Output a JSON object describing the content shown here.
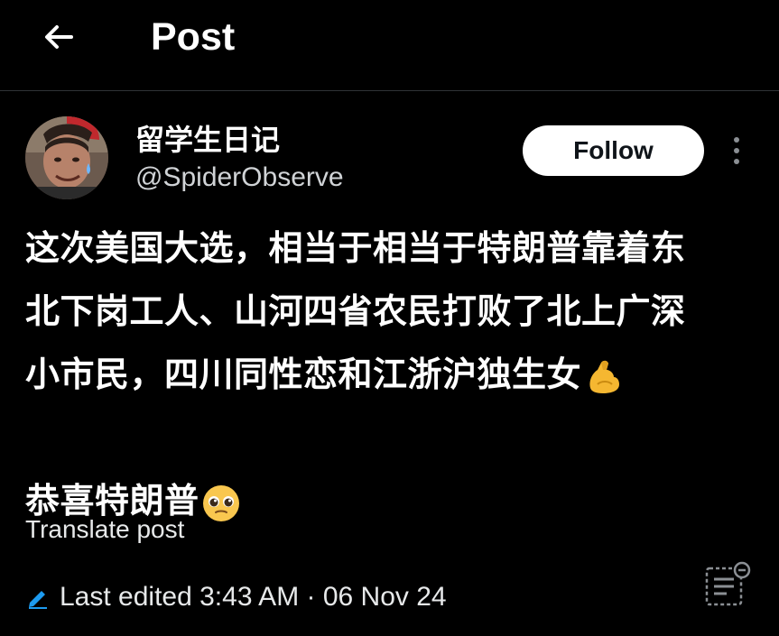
{
  "header": {
    "title": "Post",
    "back_icon": "arrow-left-icon"
  },
  "author": {
    "display_name": "留学生日记",
    "handle": "@SpiderObserve",
    "follow_label": "Follow",
    "more_icon": "more-vertical-icon"
  },
  "post": {
    "lines": [
      "这次美国大选，相当于相当于特朗普靠着东",
      "北下岗工人、山河四省农民打败了北上广深",
      "小市民，四川同性恋和江浙沪独生女",
      "恭喜特朗普"
    ],
    "emoji_line3": "flexed-biceps-emoji",
    "emoji_line4": "pleading-face-emoji",
    "translate_label": "Translate post"
  },
  "footer": {
    "edited_text": "Last edited 3:43 AM · 06 Nov 24",
    "edit_icon": "pencil-icon",
    "reader_icon": "reader-mode-icon"
  },
  "colors": {
    "background": "#000000",
    "text_primary": "#ffffff",
    "text_secondary": "#d0d3d6",
    "divider": "#2f3336",
    "accent_blue": "#1d9bf0"
  }
}
